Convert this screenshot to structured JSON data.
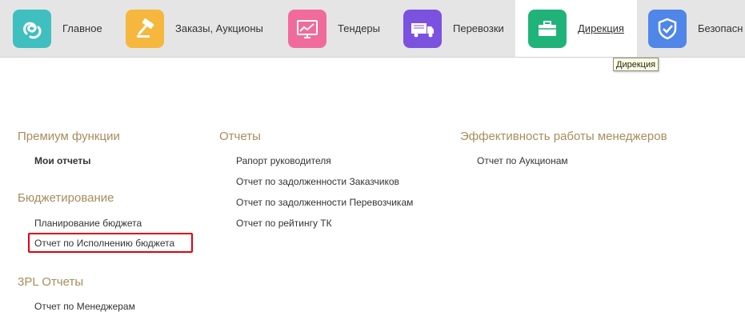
{
  "nav": {
    "tabs": [
      {
        "label": "Главное",
        "icon": "swirl-logo-icon",
        "color": "#3fbfbf"
      },
      {
        "label": "Заказы, Аукционы",
        "icon": "gavel-icon",
        "color": "#f5b73d"
      },
      {
        "label": "Тендеры",
        "icon": "chart-monitor-icon",
        "color": "#f06b9c"
      },
      {
        "label": "Перевозки",
        "icon": "truck-icon",
        "color": "#7b52e0"
      },
      {
        "label": "Дирекция",
        "icon": "briefcase-icon",
        "color": "#1fb37a"
      },
      {
        "label": "Безопасн",
        "icon": "shield-check-icon",
        "color": "#4f86e8"
      }
    ],
    "active_tab": "Дирекция",
    "tooltip": "Дирекция"
  },
  "sections": {
    "premium": {
      "title": "Премиум функции",
      "items": [
        "Мои отчеты"
      ]
    },
    "budget": {
      "title": "Бюджетирование",
      "items": [
        "Планирование бюджета",
        "Отчет по Исполнению бюджета"
      ]
    },
    "tpl": {
      "title": "3PL Отчеты",
      "items": [
        "Отчет по Менеджерам"
      ]
    },
    "reports": {
      "title": "Отчеты",
      "items": [
        "Рапорт руководителя",
        "Отчет по задолженности Заказчиков",
        "Отчет по задолженности Перевозчикам",
        "Отчет по рейтингу ТК"
      ]
    },
    "efficiency": {
      "title": "Эффективность работы менеджеров",
      "items": [
        "Отчет по Аукционам"
      ]
    }
  },
  "colors": {
    "section_title": "#a88c5c",
    "highlight_border": "#e2000f",
    "topbar_bg": "#e5e5e5"
  }
}
